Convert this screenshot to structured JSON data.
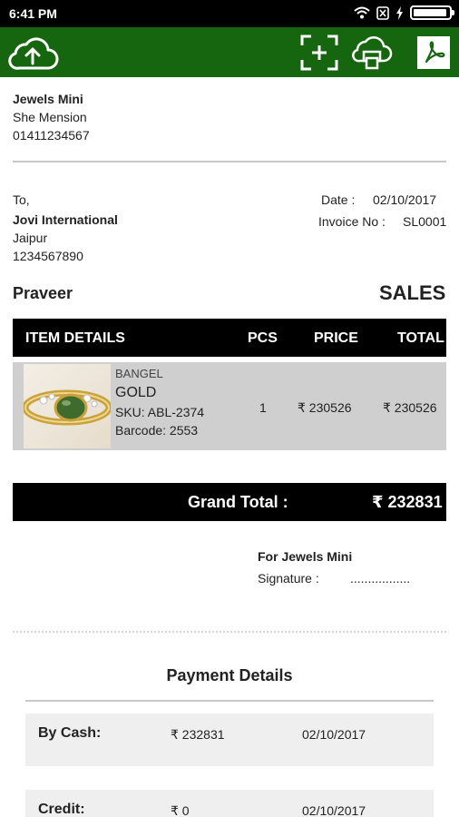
{
  "status_bar": {
    "time": "6:41 PM"
  },
  "seller": {
    "name": "Jewels Mini",
    "address": "She Mension",
    "phone": "01411234567"
  },
  "buyer": {
    "to_label": "To,",
    "name": "Jovi International",
    "city": "Jaipur",
    "phone": "1234567890"
  },
  "invoice_meta": {
    "date_label": "Date :",
    "date_value": "02/10/2017",
    "invoice_label": "Invoice No :",
    "invoice_value": "SL0001"
  },
  "customer_name": "Praveer",
  "doc_type": "SALES",
  "table": {
    "headers": {
      "item": "ITEM DETAILS",
      "pcs": "PCS",
      "price": "PRICE",
      "total": "TOTAL"
    },
    "rows": [
      {
        "category": "BANGEL",
        "metal": "GOLD",
        "sku": "SKU: ABL-2374",
        "barcode": "Barcode: 2553",
        "pcs": "1",
        "price": "₹ 230526",
        "total": "₹ 230526"
      }
    ]
  },
  "grand_total": {
    "label": "Grand Total :",
    "value": "₹ 232831"
  },
  "signature": {
    "for_label": "For Jewels Mini",
    "signature_label": "Signature :",
    "signature_line": "................."
  },
  "payment": {
    "title": "Payment Details",
    "rows": [
      {
        "label": "By Cash:",
        "amount": "₹ 232831",
        "date": "02/10/2017"
      },
      {
        "label": "Credit:",
        "amount": "₹ 0",
        "date": "02/10/2017"
      }
    ]
  },
  "colors": {
    "toolbar": "#16650f",
    "header_bar": "#000000",
    "item_row": "#cfcfcf"
  },
  "icons": [
    "wifi-icon",
    "sim-icon",
    "charging-icon",
    "battery-icon",
    "cloud-upload-icon",
    "scan-add-icon",
    "cloud-print-icon",
    "pdf-icon"
  ]
}
